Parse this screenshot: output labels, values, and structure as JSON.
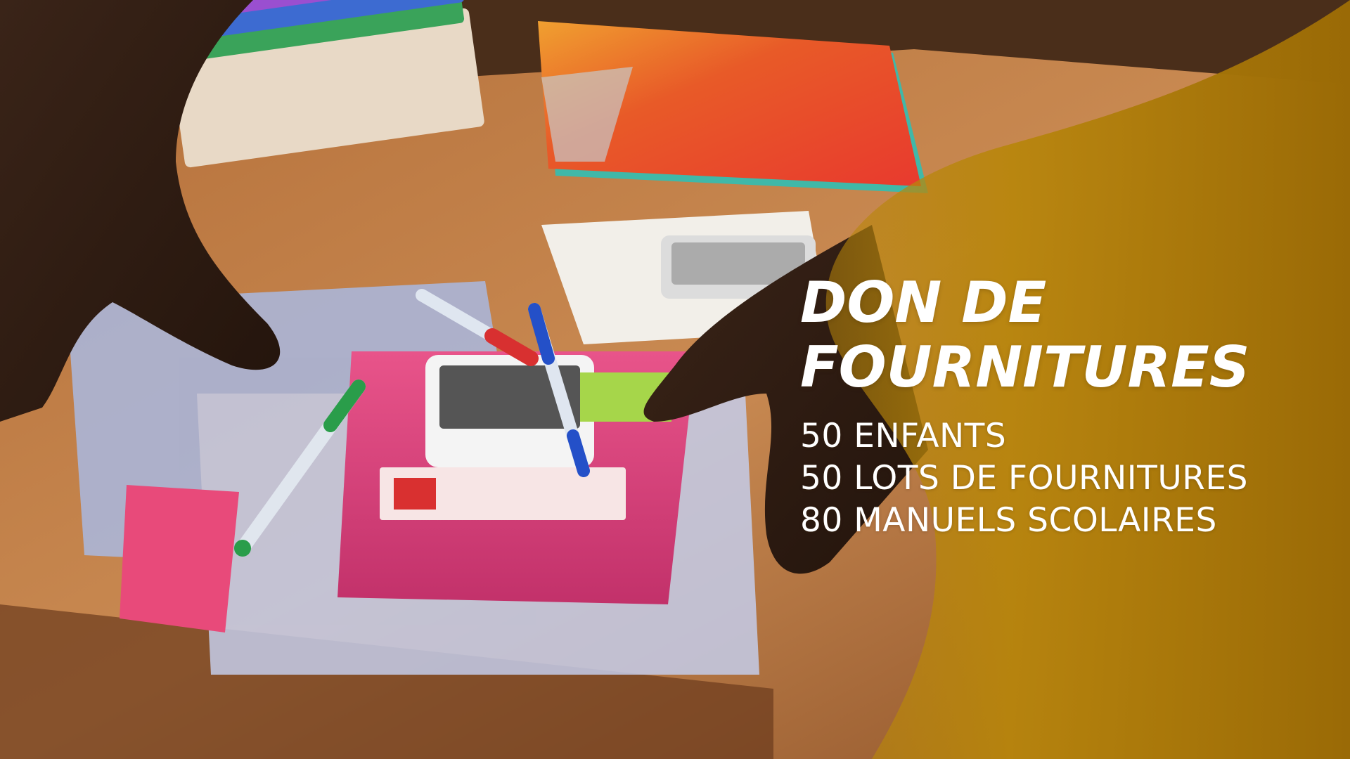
{
  "banner": {
    "title_line1": "DON DE",
    "title_line2": "FOURNITURES",
    "stats": [
      "50 ENFANTS",
      "50 LOTS DE FOURNITURES",
      "80 MANUELS SCOLAIRES"
    ],
    "colors": {
      "gold_overlay": "#b8860b",
      "gold_deep": "#9a6a06",
      "text": "#ffffff"
    }
  },
  "photo": {
    "subject": "hands-arranging-school-supplies-on-wooden-table"
  }
}
